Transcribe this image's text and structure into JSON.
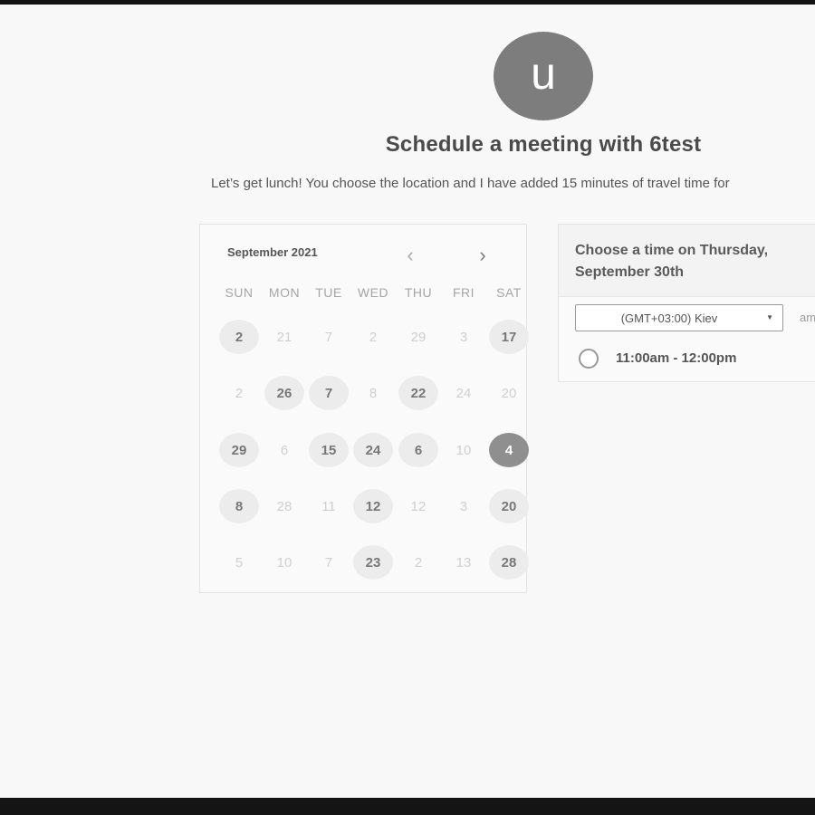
{
  "avatar": {
    "initial": "u"
  },
  "header": {
    "title": "Schedule a meeting with 6test",
    "description": "Let’s get lunch! You choose the location and I have added 15 minutes of travel time for"
  },
  "calendar": {
    "month_label": "September 2021",
    "prev_icon": "chevron-left-icon",
    "next_icon": "chevron-right-icon",
    "prev_symbol": "‹",
    "next_symbol": "›",
    "weekdays": [
      "SUN",
      "MON",
      "TUE",
      "WED",
      "THU",
      "FRI",
      "SAT"
    ],
    "weeks": [
      [
        {
          "label": "2",
          "state": "available"
        },
        {
          "label": "21",
          "state": "disabled"
        },
        {
          "label": "7",
          "state": "disabled"
        },
        {
          "label": "2",
          "state": "disabled"
        },
        {
          "label": "29",
          "state": "disabled"
        },
        {
          "label": "3",
          "state": "disabled"
        },
        {
          "label": "17",
          "state": "available"
        }
      ],
      [
        {
          "label": "2",
          "state": "disabled"
        },
        {
          "label": "26",
          "state": "available"
        },
        {
          "label": "7",
          "state": "available"
        },
        {
          "label": "8",
          "state": "disabled"
        },
        {
          "label": "22",
          "state": "available"
        },
        {
          "label": "24",
          "state": "disabled"
        },
        {
          "label": "20",
          "state": "disabled"
        }
      ],
      [
        {
          "label": "29",
          "state": "available"
        },
        {
          "label": "6",
          "state": "disabled"
        },
        {
          "label": "15",
          "state": "available"
        },
        {
          "label": "24",
          "state": "available"
        },
        {
          "label": "6",
          "state": "available"
        },
        {
          "label": "10",
          "state": "disabled"
        },
        {
          "label": "4",
          "state": "selected"
        }
      ],
      [
        {
          "label": "8",
          "state": "available"
        },
        {
          "label": "28",
          "state": "disabled"
        },
        {
          "label": "11",
          "state": "disabled"
        },
        {
          "label": "12",
          "state": "available"
        },
        {
          "label": "12",
          "state": "disabled"
        },
        {
          "label": "3",
          "state": "disabled"
        },
        {
          "label": "20",
          "state": "available"
        }
      ],
      [
        {
          "label": "5",
          "state": "disabled"
        },
        {
          "label": "10",
          "state": "disabled"
        },
        {
          "label": "7",
          "state": "disabled"
        },
        {
          "label": "23",
          "state": "available"
        },
        {
          "label": "2",
          "state": "disabled"
        },
        {
          "label": "13",
          "state": "disabled"
        },
        {
          "label": "28",
          "state": "available"
        }
      ]
    ]
  },
  "time_panel": {
    "title": "Choose a time on Thursday, September 30th",
    "timezone": {
      "value": "(GMT+03:00) Kiev",
      "caret_icon": "caret-down-icon",
      "caret_symbol": "▼"
    },
    "format_label": "am/pm",
    "slots": [
      {
        "label": "11:00am - 12:00pm"
      }
    ]
  },
  "colors": {
    "selected_day": "#8f8f8f",
    "available_day": "#ececec",
    "avatar": "#7d7d7d",
    "frame": "#141414"
  }
}
